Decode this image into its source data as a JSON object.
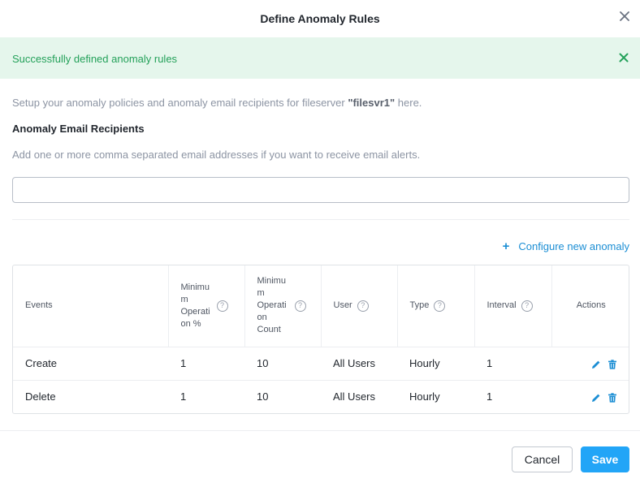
{
  "dialog": {
    "title": "Define Anomaly Rules"
  },
  "banner": {
    "message": "Successfully defined anomaly rules"
  },
  "intro": {
    "prefix": "Setup your anomaly policies and anomaly email recipients for fileserver ",
    "fileserver": "\"filesvr1\"",
    "suffix": " here."
  },
  "recipients": {
    "title": "Anomaly Email Recipients",
    "help": "Add one or more comma separated email addresses if you want to receive email alerts.",
    "value": "",
    "placeholder": ""
  },
  "configure_link": {
    "plus": "+",
    "label": "Configure new anomaly"
  },
  "table": {
    "headers": {
      "events": "Events",
      "min_pct": "Minimu m Operati on %",
      "min_count": "Minimu m Operati on Count",
      "user": "User",
      "type": "Type",
      "interval": "Interval",
      "actions": "Actions"
    },
    "rows": [
      {
        "event": "Create",
        "min_pct": "1",
        "min_count": "10",
        "user": "All Users",
        "type": "Hourly",
        "interval": "1"
      },
      {
        "event": "Delete",
        "min_pct": "1",
        "min_count": "10",
        "user": "All Users",
        "type": "Hourly",
        "interval": "1"
      }
    ]
  },
  "buttons": {
    "cancel": "Cancel",
    "save": "Save"
  },
  "colors": {
    "accent": "#1b8ed4",
    "primary_button": "#22a5f7",
    "success_bg": "#e5f6ec",
    "success_text": "#24a15a"
  },
  "icons": [
    "close-icon",
    "banner-close-icon",
    "plus-icon",
    "help-icon",
    "edit-icon",
    "delete-icon"
  ]
}
